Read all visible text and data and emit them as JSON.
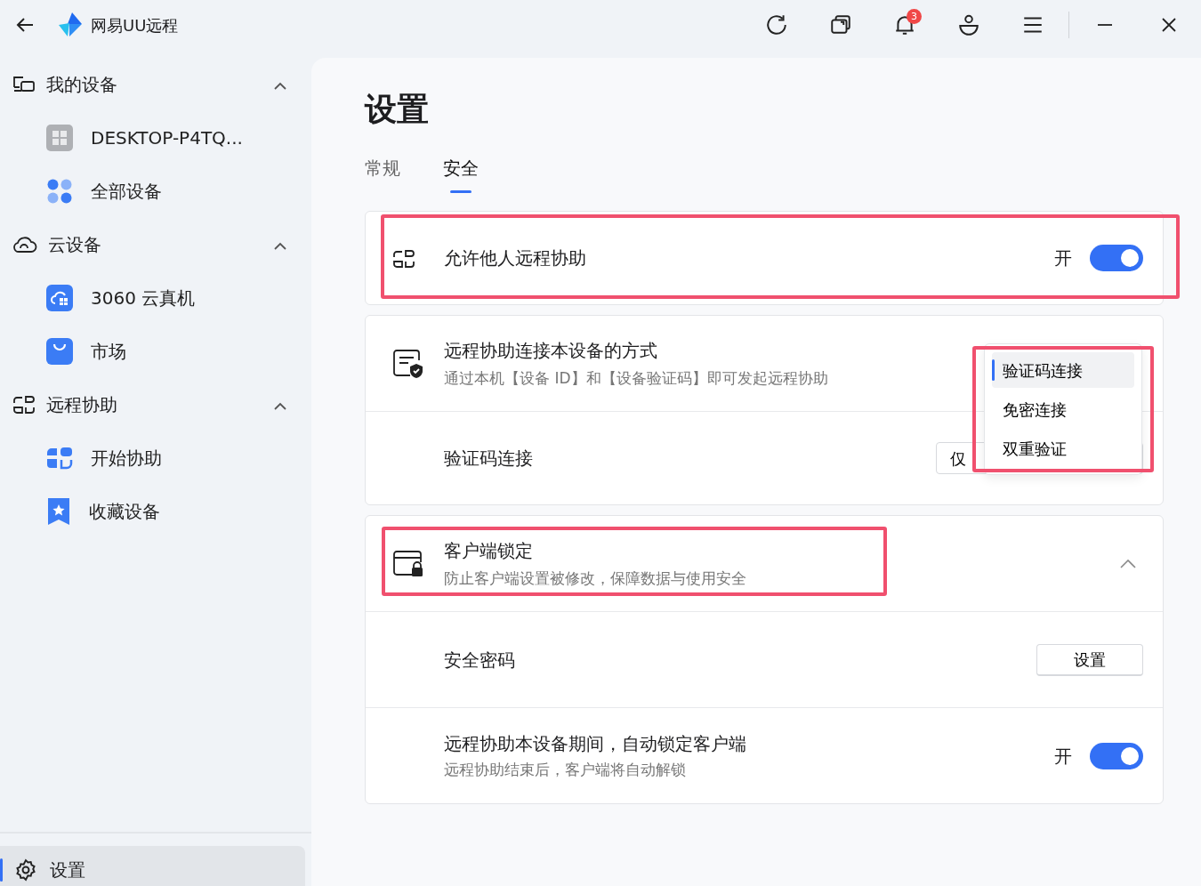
{
  "app": {
    "title": "网易UU远程",
    "notification_count": "3"
  },
  "sidebar": {
    "groups": [
      {
        "label": "我的设备",
        "expanded": true,
        "items": [
          {
            "label": "DESKTOP-P4TQ..."
          },
          {
            "label": "全部设备"
          }
        ]
      },
      {
        "label": "云设备",
        "expanded": true,
        "items": [
          {
            "label": "3060 云真机"
          },
          {
            "label": "市场"
          }
        ]
      },
      {
        "label": "远程协助",
        "expanded": true,
        "items": [
          {
            "label": "开始协助"
          },
          {
            "label": "收藏设备"
          }
        ]
      }
    ],
    "footer": {
      "label": "设置",
      "selected": true
    }
  },
  "page": {
    "title": "设置",
    "tabs": [
      {
        "label": "常规",
        "selected": false
      },
      {
        "label": "安全",
        "selected": true
      }
    ]
  },
  "sections": [
    {
      "kind": "toggle",
      "title": "允许他人远程协助",
      "state_label": "开",
      "on": true,
      "highlighted": true
    },
    {
      "kind": "group",
      "title": "远程协助连接本设备的方式",
      "description": "通过本机【设备 ID】和【设备验证码】即可发起远程协助",
      "highlighted": false,
      "rows": [
        {
          "kind": "select",
          "label": "验证码连接",
          "value": "仅"
        }
      ],
      "dropdown": {
        "highlighted": true,
        "options": [
          {
            "label": "验证码连接",
            "selected": true
          },
          {
            "label": "免密连接",
            "selected": false
          },
          {
            "label": "双重验证",
            "selected": false
          }
        ]
      }
    },
    {
      "kind": "group",
      "title": "客户端锁定",
      "description": "防止客户端设置被修改，保障数据与使用安全",
      "expanded": true,
      "highlighted": true,
      "rows": [
        {
          "kind": "button",
          "label": "安全密码",
          "button": "设置"
        },
        {
          "kind": "toggle",
          "label": "远程协助本设备期间，自动锁定客户端",
          "description": "远程协助结束后，客户端将自动解锁",
          "state_label": "开",
          "on": true
        }
      ]
    }
  ]
}
